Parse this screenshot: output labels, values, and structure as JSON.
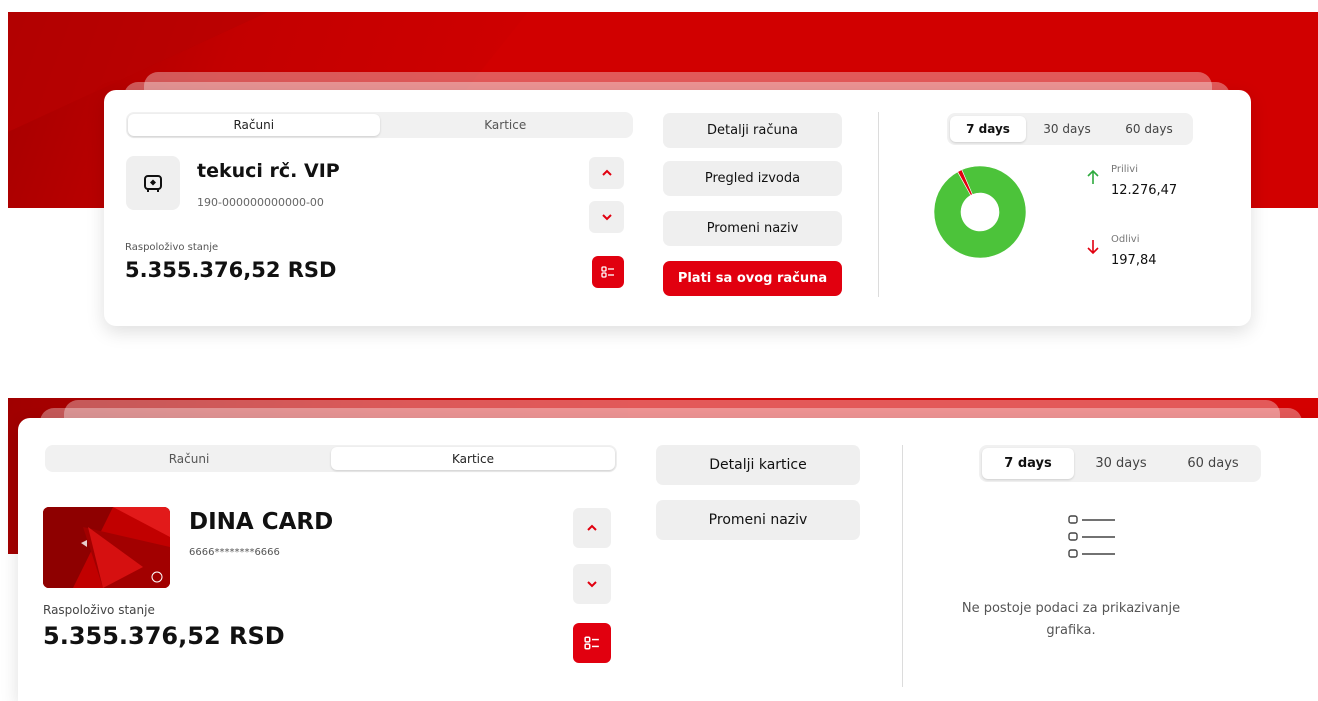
{
  "colors": {
    "brand_red": "#e1000f",
    "inflow_green": "#2eaa3e",
    "outflow_red": "#e1000f",
    "donut_green": "#4cc33a"
  },
  "account_panel": {
    "tabs": [
      "Računi",
      "Kartice"
    ],
    "active_tab": "Računi",
    "account_icon": "wallet-icon",
    "name": "tekuci rč. VIP",
    "number": "190-000000000000-00",
    "balance_label": "Raspoloživo stanje",
    "balance": "5.355.376,52 RSD",
    "actions": {
      "details": "Detalji računa",
      "statements": "Pregled izvoda",
      "rename": "Promeni naziv",
      "pay": "Plati sa ovog računa"
    },
    "periods": [
      "7 days",
      "30 days",
      "60 days"
    ],
    "active_period": "7 days",
    "inflow": {
      "label": "Prilivi",
      "value": "12.276,47"
    },
    "outflow": {
      "label": "Odlivi",
      "value": "197,84"
    }
  },
  "card_panel": {
    "tabs": [
      "Računi",
      "Kartice"
    ],
    "active_tab": "Kartice",
    "name": "DINA CARD",
    "number": "6666********6666",
    "balance_label": "Raspoloživo stanje",
    "balance": "5.355.376,52 RSD",
    "actions": {
      "details": "Detalji kartice",
      "rename": "Promeni naziv"
    },
    "periods": [
      "7 days",
      "30 days",
      "60 days"
    ],
    "active_period": "7 days",
    "empty_message": "Ne postoje podaci za prikazivanje grafika."
  },
  "chart_data": {
    "type": "pie",
    "categories": [
      "Prilivi",
      "Odlivi"
    ],
    "values": [
      12276.47,
      197.84
    ]
  }
}
